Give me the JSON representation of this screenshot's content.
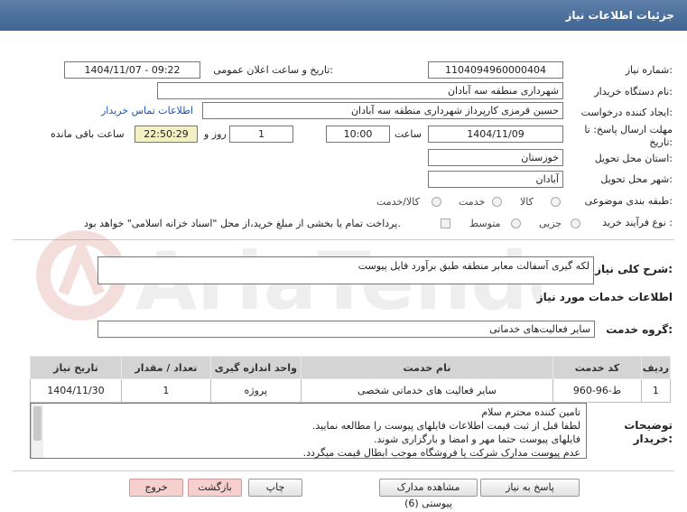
{
  "header": {
    "title": "جزئیات اطلاعات نیاز"
  },
  "form": {
    "need_number_label": "شماره نیاز:",
    "need_number": "1104094960000404",
    "announce_label": "تاریخ و ساعت اعلان عمومی:",
    "announce_value": "1404/11/07 - 09:22",
    "buyer_org_label": "نام دستگاه خریدار:",
    "buyer_org": "شهرداری منطقه سه آبادان",
    "creator_label": "ایجاد کننده درخواست:",
    "creator": "حسین قرمزی کارپرداز شهرداری منطقه سه آبادان",
    "contact_link": "اطلاعات تماس خریدار",
    "deadline_label_1": "مهلت ارسال پاسخ: تا",
    "deadline_label_2": "تاریخ:",
    "deadline_date": "1404/11/09",
    "time_label": "ساعت",
    "deadline_time": "10:00",
    "days_value": "1",
    "days_label": "روز و",
    "remaining_time": "22:50:29",
    "remaining_label": "ساعت باقی مانده",
    "province_label": "استان محل تحویل:",
    "province": "خوزستان",
    "city_label": "شهر محل تحویل:",
    "city": "آبادان",
    "category_label": "طبقه بندی موضوعی:",
    "category_options": [
      "کالا",
      "خدمت",
      "کالا/خدمت"
    ],
    "purchase_type_label": "نوع فرآیند خرید :",
    "purchase_options": [
      "جزیی",
      "متوسط"
    ],
    "treasury_note": "پرداخت تمام یا بخشی از مبلغ خرید،از محل \"اسناد خزانه اسلامی\" خواهد بود."
  },
  "summary": {
    "label": "شرح کلی نیاز:",
    "value": "لکه گیری آسفالت معابر منطقه طبق برآورد فایل پیوست"
  },
  "services_title": "اطلاعات خدمات مورد نیاز",
  "service_group": {
    "label": "گروه خدمت:",
    "value": "سایر فعالیت‌های خدماتی"
  },
  "table": {
    "headers": [
      "ردیف",
      "کد خدمت",
      "نام خدمت",
      "واحد اندازه گیری",
      "تعداد / مقدار",
      "تاریخ نیاز"
    ],
    "rows": [
      [
        "1",
        "ط-96-960",
        "سایر فعالیت های خدماتی شخصی",
        "پروژه",
        "1",
        "1404/11/30"
      ]
    ]
  },
  "buyer_notes": {
    "label_1": "توضیحات",
    "label_2": "خریدار:",
    "lines": [
      "تامین کننده محترم سلام",
      "لطفا قبل از ثبت قیمت اطلاعات فایلهای پیوست را مطالعه نمایید.",
      "فایلهای پیوست حتما مهر و امضا و بارگزاری شوند.",
      "عدم پیوست مدارک شرکت یا فروشگاه موجب ابطال قیمت میگردد."
    ]
  },
  "buttons": {
    "reply": "پاسخ به نیاز",
    "attachments": "مشاهده مدارک پیوستی (6)",
    "print": "چاپ",
    "back": "بازگشت",
    "exit": "خروج"
  },
  "colors": {
    "header_bg": "#4a6d99",
    "link": "#1a56b0",
    "remaining_bg": "#f3f0c4"
  }
}
